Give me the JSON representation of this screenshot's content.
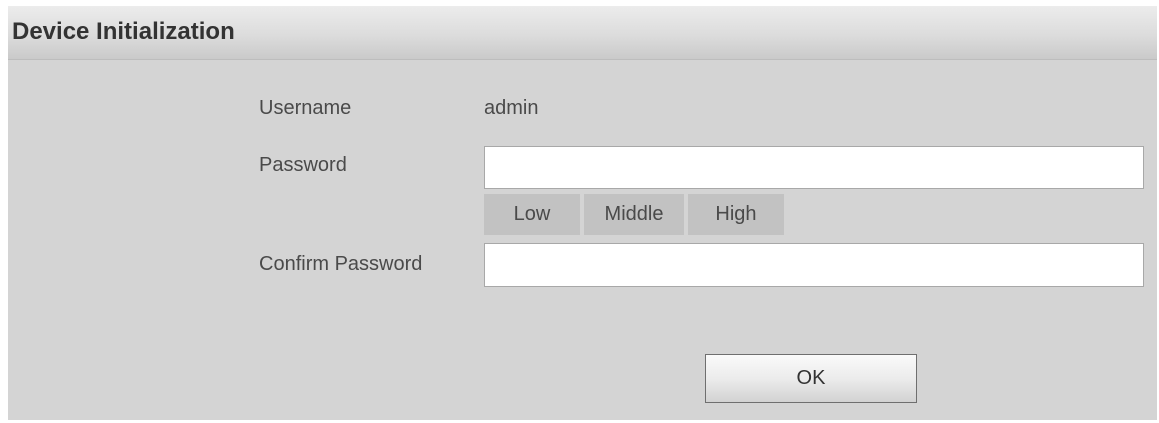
{
  "dialog": {
    "title": "Device Initialization"
  },
  "form": {
    "username_label": "Username",
    "username_value": "admin",
    "password_label": "Password",
    "password_value": "",
    "confirm_label": "Confirm Password",
    "confirm_value": ""
  },
  "strength": {
    "low": "Low",
    "middle": "Middle",
    "high": "High"
  },
  "buttons": {
    "ok": "OK"
  }
}
